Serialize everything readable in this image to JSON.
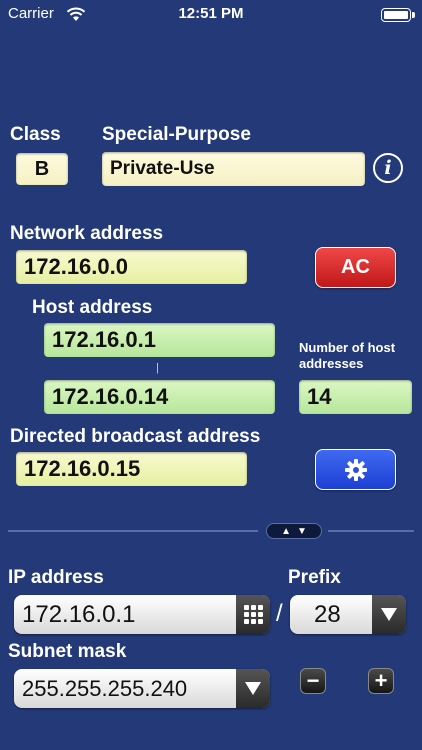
{
  "status_bar": {
    "carrier": "Carrier",
    "time": "12:51 PM"
  },
  "class": {
    "label": "Class",
    "value": "B"
  },
  "special_purpose": {
    "label": "Special-Purpose",
    "value": "Private-Use"
  },
  "network": {
    "label": "Network address",
    "value": "172.16.0.0"
  },
  "ac_button": {
    "label": "AC"
  },
  "host": {
    "label": "Host address",
    "first": "172.16.0.1",
    "separator": "|",
    "last": "172.16.0.14"
  },
  "host_count": {
    "label": "Number of host addresses",
    "value": "14"
  },
  "broadcast": {
    "label": "Directed broadcast address",
    "value": "172.16.0.15"
  },
  "ip_input": {
    "label": "IP address",
    "value": "172.16.0.1"
  },
  "slash": "/",
  "prefix": {
    "label": "Prefix",
    "value": "28"
  },
  "subnet": {
    "label": "Subnet mask",
    "value": "255.255.255.240"
  },
  "stepper": {
    "minus": "−",
    "plus": "+"
  },
  "colors": {
    "background": "#243a78",
    "ac_red": "#d82828",
    "settings_blue": "#2a4fe0"
  }
}
